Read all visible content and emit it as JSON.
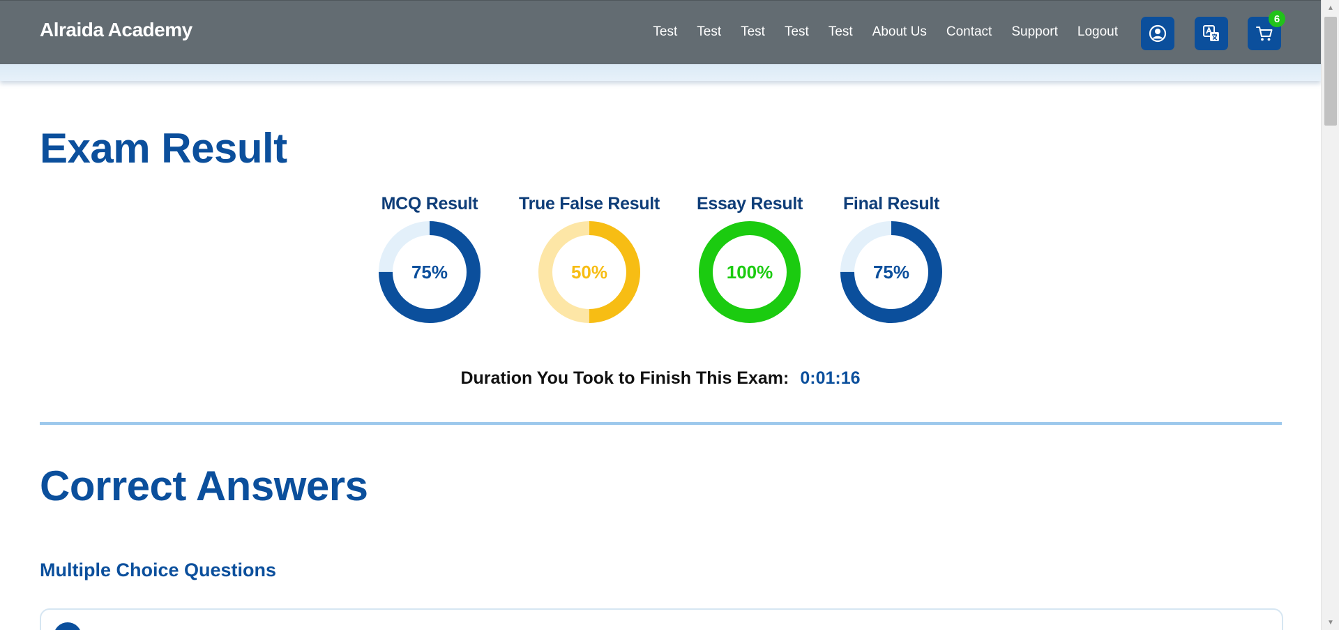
{
  "header": {
    "brand": "Alraida Academy",
    "nav_links": [
      {
        "label": "Test"
      },
      {
        "label": "Test"
      },
      {
        "label": "Test"
      },
      {
        "label": "Test"
      },
      {
        "label": "Test"
      },
      {
        "label": "About Us"
      },
      {
        "label": "Contact"
      },
      {
        "label": "Support"
      },
      {
        "label": "Logout"
      }
    ],
    "icons": {
      "profile": "user-circle-icon",
      "language": "translate-icon",
      "cart": "shopping-cart-icon"
    },
    "cart_count": "6",
    "background_color": "#636c72",
    "button_color": "#0b4f9c"
  },
  "exam_result": {
    "title": "Exam Result",
    "results": [
      {
        "label": "MCQ Result",
        "value": "75%",
        "percent": 75,
        "color": "#0b4f9c",
        "track_color": "#e3f0fa"
      },
      {
        "label": "True False Result",
        "value": "50%",
        "percent": 50,
        "color": "#f7bd14",
        "track_color": "#fde6a6"
      },
      {
        "label": "Essay Result",
        "value": "100%",
        "percent": 100,
        "color": "#1bcb10",
        "track_color": "#c9f2c6"
      },
      {
        "label": "Final Result",
        "value": "75%",
        "percent": 75,
        "color": "#0b4f9c",
        "track_color": "#e3f0fa"
      }
    ],
    "duration_label": "Duration You Took to Finish This Exam:",
    "duration_value": "0:01:16"
  },
  "correct_answers": {
    "title": "Correct Answers",
    "section_title": "Multiple Choice Questions"
  }
}
